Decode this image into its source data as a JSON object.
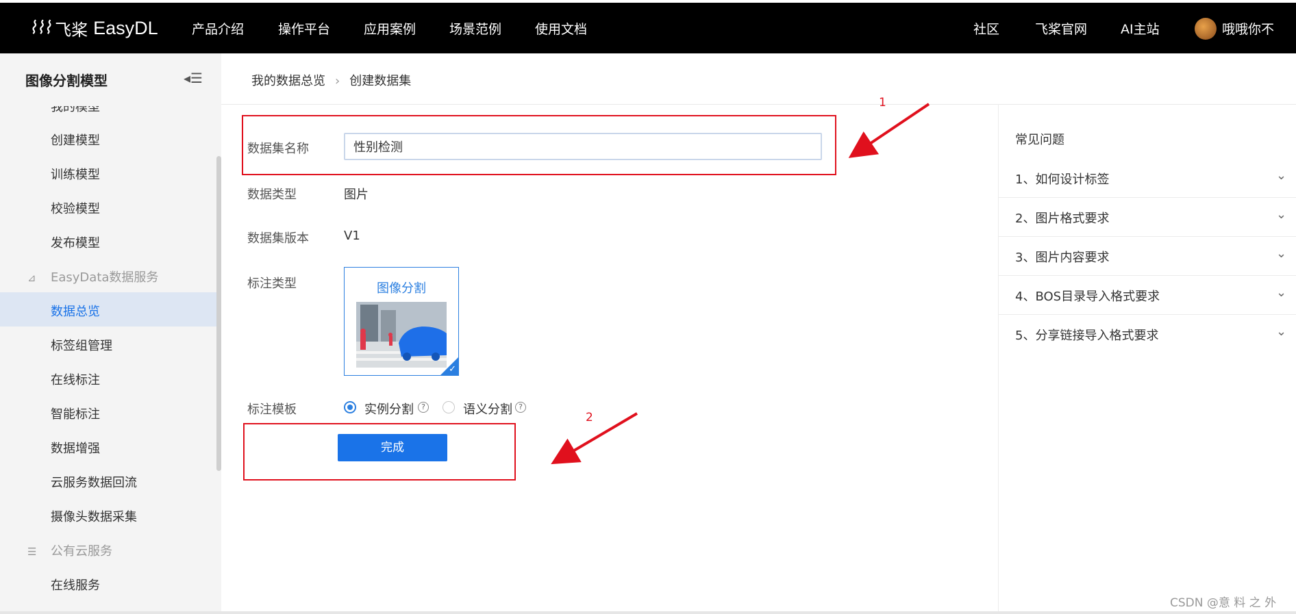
{
  "topbar": {
    "brand_cn": "飞桨",
    "brand_en": "EasyDL",
    "nav": [
      "产品介绍",
      "操作平台",
      "应用案例",
      "场景范例",
      "使用文档"
    ],
    "right_nav": [
      "社区",
      "飞桨官网",
      "AI主站"
    ],
    "username": "哦哦你不"
  },
  "sidebar": {
    "title": "图像分割模型",
    "items_top": [
      "我的模型",
      "创建模型",
      "训练模型",
      "校验模型",
      "发布模型"
    ],
    "group_data": "EasyData数据服务",
    "items_data": [
      "数据总览",
      "标签组管理",
      "在线标注",
      "智能标注",
      "数据增强",
      "云服务数据回流",
      "摄像头数据采集"
    ],
    "group_cloud": "公有云服务",
    "items_cloud": [
      "在线服务"
    ],
    "active": "数据总览"
  },
  "breadcrumb": {
    "parent": "我的数据总览",
    "current": "创建数据集"
  },
  "form": {
    "name_label": "数据集名称",
    "name_value": "性别检测",
    "type_label": "数据类型",
    "type_value": "图片",
    "version_label": "数据集版本",
    "version_value": "V1",
    "annotation_label": "标注类型",
    "annotation_card": "图像分割",
    "template_label": "标注模板",
    "template_options": [
      "实例分割",
      "语义分割"
    ],
    "template_selected": "实例分割",
    "submit": "完成"
  },
  "annotations": {
    "n1": "1",
    "n2": "2",
    "color": "#e0101d"
  },
  "faq": {
    "title": "常见问题",
    "items": [
      "1、如何设计标签",
      "2、图片格式要求",
      "3、图片内容要求",
      "4、BOS目录导入格式要求",
      "5、分享链接导入格式要求"
    ]
  },
  "watermark": "CSDN @意 料 之 外",
  "colors": {
    "accent": "#1a73e8",
    "topbar": "#000000",
    "sidebar_active": "#dde6f3"
  }
}
